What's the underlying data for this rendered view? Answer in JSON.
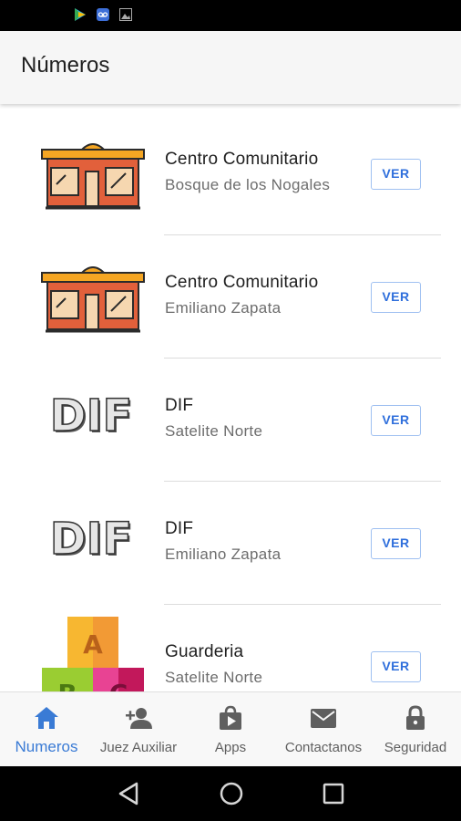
{
  "status_bar": {
    "icons": [
      "play-store-icon",
      "voicemail-icon",
      "image-icon"
    ]
  },
  "app_bar": {
    "title": "Números"
  },
  "list": {
    "items": [
      {
        "title": "Centro Comunitario",
        "subtitle": "Bosque de los Nogales",
        "button": "VER",
        "image": "community-center-icon"
      },
      {
        "title": "Centro Comunitario",
        "subtitle": "Emiliano Zapata",
        "button": "VER",
        "image": "community-center-icon"
      },
      {
        "title": "DIF",
        "subtitle": "Satelite Norte",
        "button": "VER",
        "image": "dif-logo",
        "logo_text": "DIF"
      },
      {
        "title": "DIF",
        "subtitle": "Emiliano Zapata",
        "button": "VER",
        "image": "dif-logo",
        "logo_text": "DIF"
      },
      {
        "title": "Guarderia",
        "subtitle": "Satelite Norte",
        "button": "VER",
        "image": "abc-blocks-icon",
        "block_letters": [
          "A",
          "B",
          "C"
        ]
      }
    ]
  },
  "bottom_nav": {
    "items": [
      {
        "label": "Numeros",
        "icon": "home-icon",
        "active": true
      },
      {
        "label": "Juez Auxiliar",
        "icon": "add-person-icon",
        "active": false
      },
      {
        "label": "Apps",
        "icon": "shopping-bag-play-icon",
        "active": false
      },
      {
        "label": "Contactanos",
        "icon": "mail-icon",
        "active": false
      },
      {
        "label": "Seguridad",
        "icon": "lock-icon",
        "active": false
      }
    ]
  },
  "colors": {
    "accent": "#3a7bd5",
    "ver_border": "#9fc0f1",
    "building_orange": "#f5a623",
    "building_brick": "#e2603b"
  }
}
